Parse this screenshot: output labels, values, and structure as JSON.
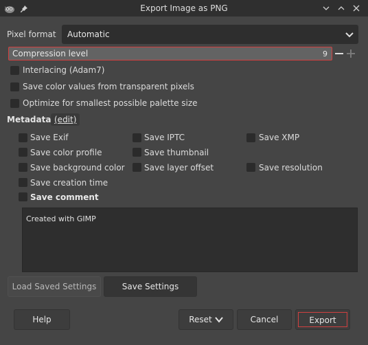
{
  "window": {
    "title": "Export Image as PNG"
  },
  "pixel_format": {
    "label": "Pixel format",
    "value": "Automatic"
  },
  "compression": {
    "label": "Compression level",
    "value": "9"
  },
  "options": [
    {
      "label": "Interlacing (Adam7)",
      "checked": false
    },
    {
      "label": "Save color values from transparent pixels",
      "checked": false
    },
    {
      "label": "Optimize for smallest possible palette size",
      "checked": false
    }
  ],
  "metadata": {
    "title": "Metadata",
    "edit_label": "(edit)",
    "items": [
      {
        "label": "Save Exif",
        "checked": false
      },
      {
        "label": "Save IPTC",
        "checked": false
      },
      {
        "label": "Save XMP",
        "checked": false
      },
      {
        "label": "Save color profile",
        "checked": false
      },
      {
        "label": "Save thumbnail",
        "checked": false
      },
      {
        "label": "Save background color",
        "checked": false
      },
      {
        "label": "Save layer offset",
        "checked": false
      },
      {
        "label": "Save resolution",
        "checked": false
      },
      {
        "label": "Save creation time",
        "checked": false
      },
      {
        "label": "Save comment",
        "checked": false
      }
    ]
  },
  "comment": {
    "text": "Created with GIMP"
  },
  "buttons": {
    "load_settings": "Load Saved Settings",
    "save_settings": "Save Settings",
    "help": "Help",
    "reset": "Reset",
    "cancel": "Cancel",
    "export": "Export"
  }
}
